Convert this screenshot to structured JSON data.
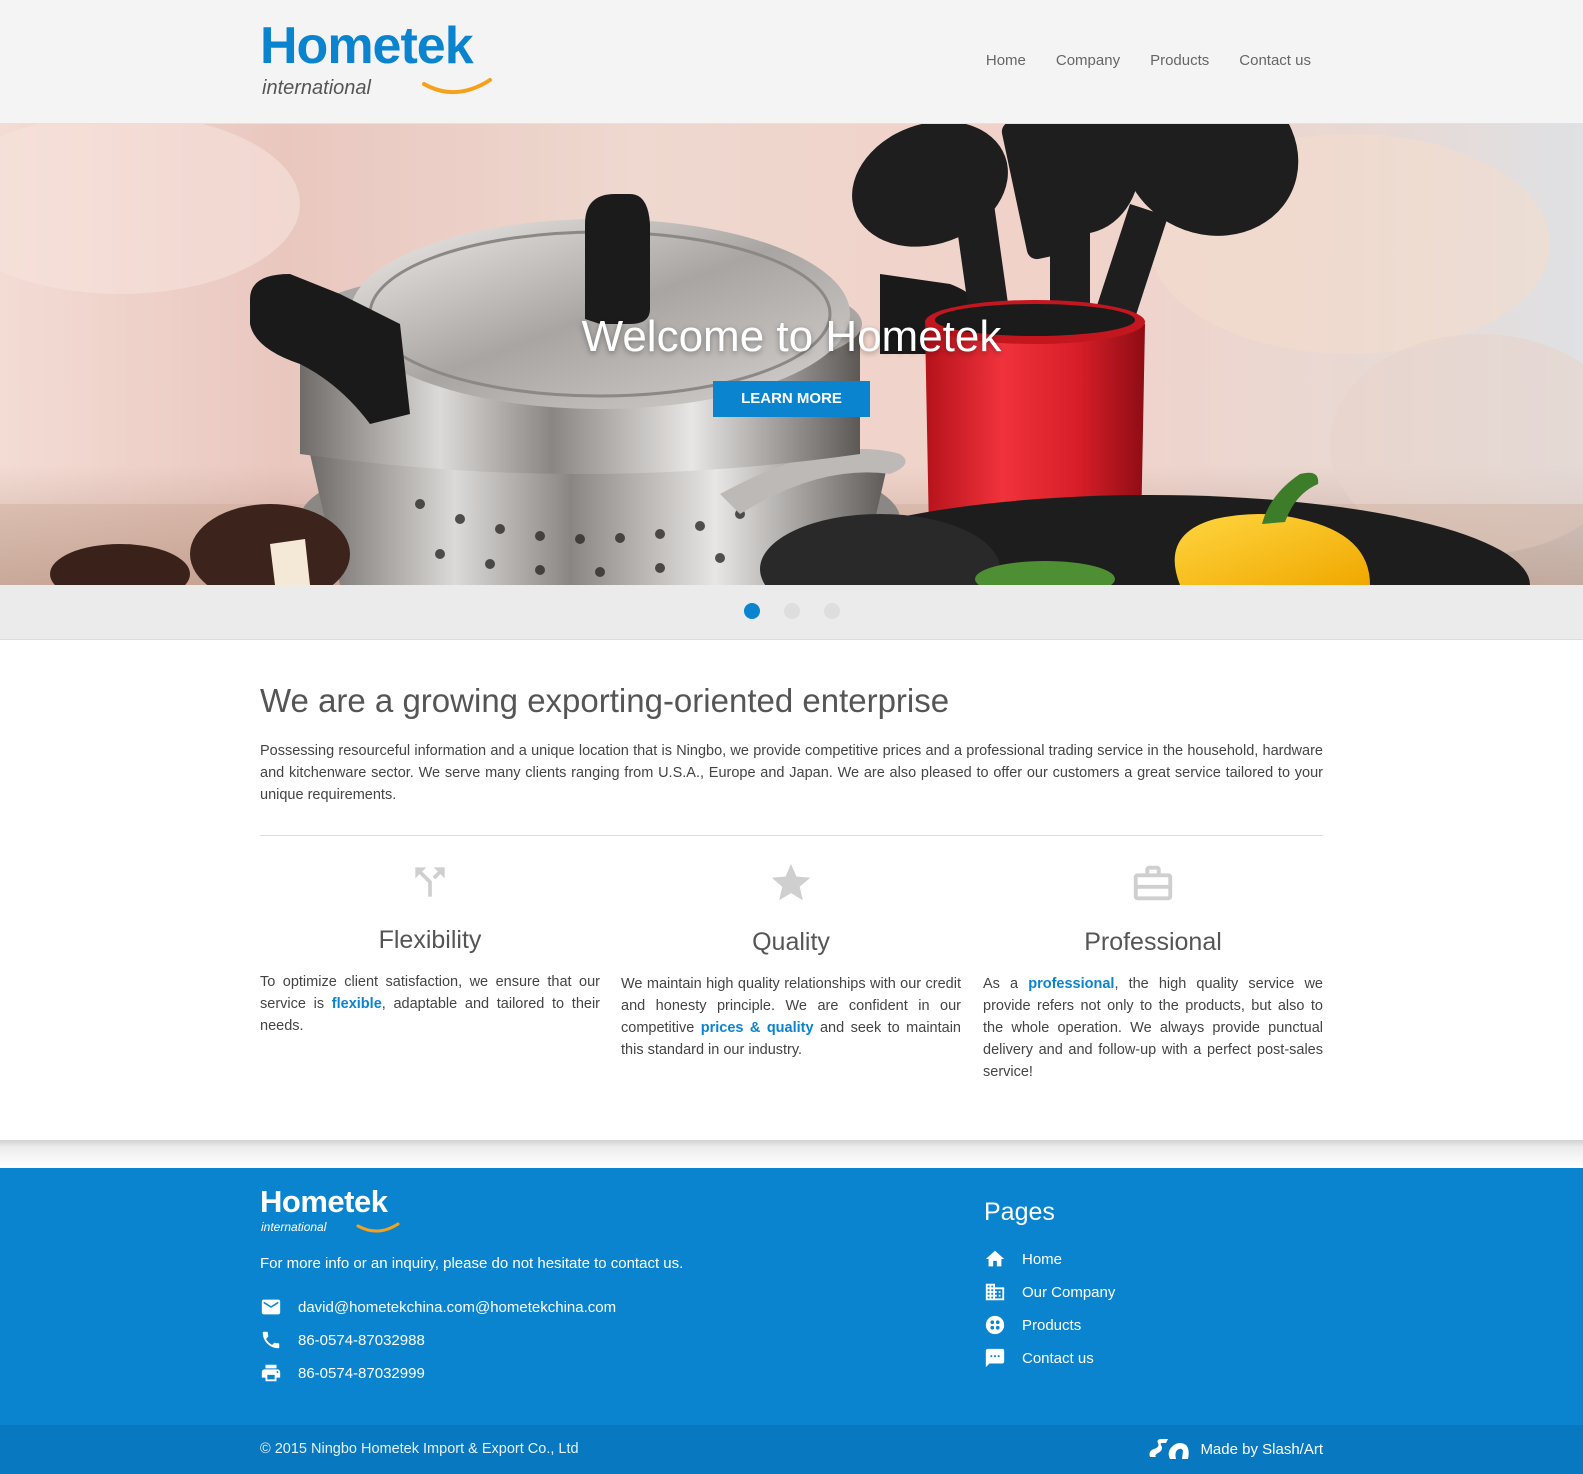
{
  "header": {
    "logo_word": "Hometek",
    "logo_sub": "international",
    "nav": [
      {
        "label": "Home"
      },
      {
        "label": "Company"
      },
      {
        "label": "Products"
      },
      {
        "label": "Contact us"
      }
    ]
  },
  "hero": {
    "title": "Welcome to Hometek",
    "button_label": "LEARN MORE",
    "slides_count": 3,
    "active_slide": 1
  },
  "main": {
    "heading": "We are a growing exporting-oriented enterprise",
    "intro": "Possessing resourceful information and a unique location that is Ningbo, we provide competitive prices and a professional trading service in the household, hardware and kitchenware sector. We serve many clients ranging from U.S.A., Europe and Japan. We are also pleased to offer our customers a great service tailored to your unique requirements.",
    "features": [
      {
        "icon": "call-split-icon",
        "title": "Flexibility",
        "text_before": "To optimize client satisfaction, we ensure that our service is ",
        "link": "flexible",
        "text_after": ", adaptable and tailored to their needs."
      },
      {
        "icon": "star-icon",
        "title": "Quality",
        "text_before": "We maintain high quality relationships with our credit and honesty principle. We are confident in our competitive ",
        "link": "prices & quality",
        "text_after": " and seek to maintain this standard in our industry."
      },
      {
        "icon": "briefcase-icon",
        "title": "Professional",
        "text_before": "As a ",
        "link": "professional",
        "text_after": ", the high quality service we provide refers not only to the products, but also to the whole operation. We always provide punctual delivery and and follow-up with a perfect post-sales service!"
      }
    ]
  },
  "footer": {
    "logo_word": "Hometek",
    "logo_sub": "international",
    "tagline": "For more info or an inquiry, please do not hesitate to contact us.",
    "contacts": [
      {
        "icon": "email-icon",
        "value": "david@hometekchina.com@hometekchina.com"
      },
      {
        "icon": "phone-icon",
        "value": "86-0574-87032988"
      },
      {
        "icon": "fax-printer-icon",
        "value": "86-0574-87032999"
      }
    ],
    "pages_title": "Pages",
    "pages": [
      {
        "icon": "home-icon",
        "label": "Home"
      },
      {
        "icon": "building-icon",
        "label": "Our Company"
      },
      {
        "icon": "products-icon",
        "label": "Products"
      },
      {
        "icon": "chat-icon",
        "label": "Contact us"
      }
    ],
    "copyright": "© 2015 Ningbo Hometek Import & Export Co., Ltd",
    "made_by": "Made by Slash/Art"
  },
  "colors": {
    "brand_blue": "#0a84cf",
    "accent_orange": "#f5a21a"
  }
}
